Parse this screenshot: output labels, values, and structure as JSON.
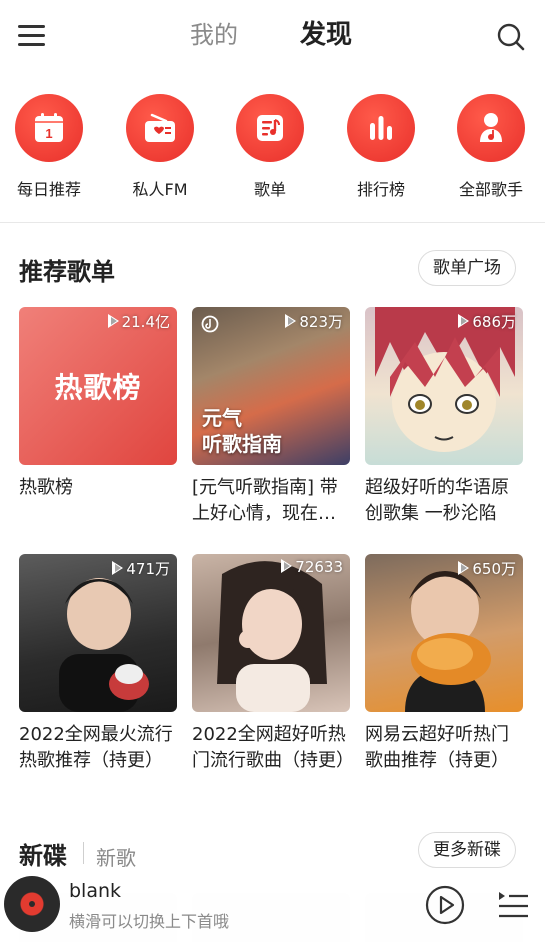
{
  "header": {
    "tab_mine": "我的",
    "tab_discover": "发现"
  },
  "categories": [
    {
      "label": "每日推荐",
      "icon": "calendar-icon"
    },
    {
      "label": "私人FM",
      "icon": "radio-icon"
    },
    {
      "label": "歌单",
      "icon": "playlist-icon"
    },
    {
      "label": "排行榜",
      "icon": "chart-bars-icon"
    },
    {
      "label": "全部歌手",
      "icon": "singer-icon"
    }
  ],
  "recommend": {
    "title": "推荐歌单",
    "more_button": "歌单广场",
    "playlists": [
      {
        "cover_text": "热歌榜",
        "plays": "21.4亿",
        "title": "热歌榜"
      },
      {
        "cover_text_line1": "元气",
        "cover_text_line2": "听歌指南",
        "plays": "823万",
        "title": "[元气听歌指南] 带上好心情，现在出发吧"
      },
      {
        "plays": "686万",
        "title": "超级好听的华语原创歌集 一秒沦陷"
      },
      {
        "plays": "471万",
        "title": "2022全网最火流行热歌推荐（持更）"
      },
      {
        "plays": "72633",
        "title": "2022全网超好听热门流行歌曲（持更）"
      },
      {
        "plays": "650万",
        "title": "网易云超好听热门歌曲推荐（持更）"
      }
    ]
  },
  "new_releases": {
    "title": "新碟",
    "sub_tab": "新歌",
    "more_button": "更多新碟"
  },
  "player": {
    "song": "blank",
    "hint": "横滑可以切换上下首哦"
  },
  "colors": {
    "accent": "#e8302b",
    "text": "#222222",
    "muted": "#8a8a8a"
  }
}
